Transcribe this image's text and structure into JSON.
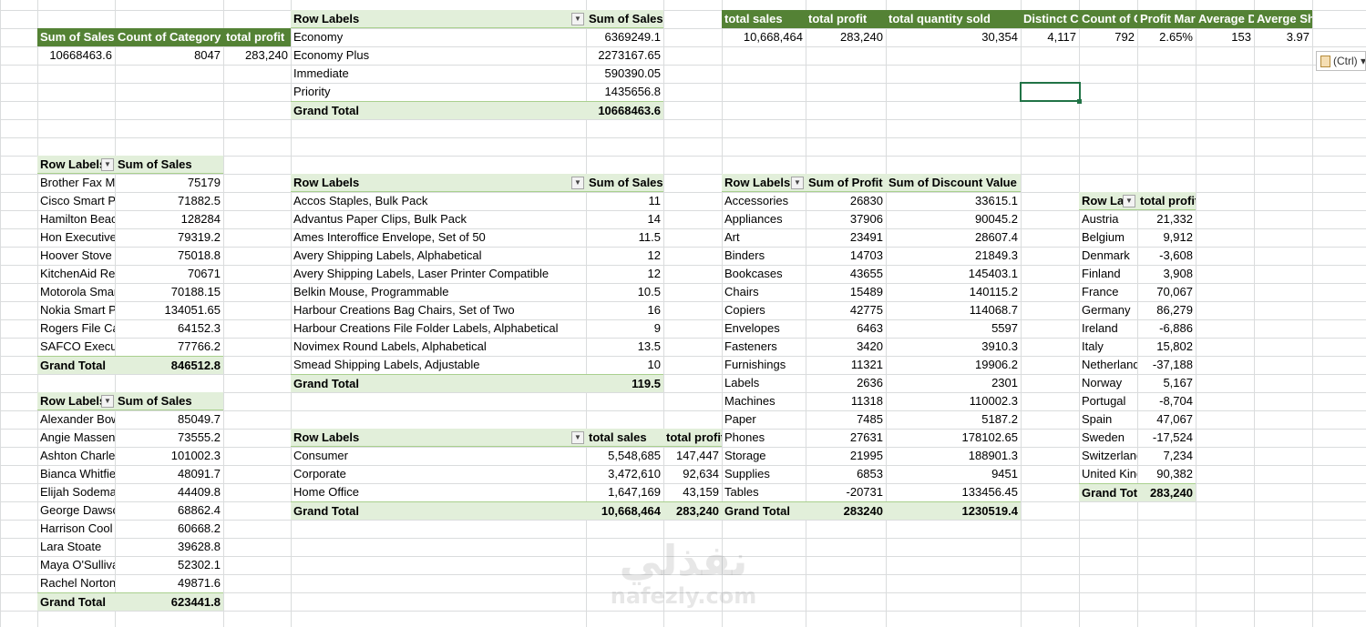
{
  "kpi_small": {
    "headers": [
      "Sum of Sales",
      "Count of Category",
      "total profit"
    ],
    "values": [
      "10668463.6",
      "8047",
      "283,240"
    ]
  },
  "pivot_shipmode": {
    "row_label": "Row Labels",
    "value_label": "Sum of Sales",
    "rows": [
      {
        "label": "Economy",
        "value": "6369249.1"
      },
      {
        "label": "Economy Plus",
        "value": "2273167.65"
      },
      {
        "label": "Immediate",
        "value": "590390.05"
      },
      {
        "label": "Priority",
        "value": "1435656.8"
      }
    ],
    "total_label": "Grand Total",
    "total_value": "10668463.6"
  },
  "kpi_wide": {
    "headers": [
      "total sales",
      "total profit",
      "total quantity sold",
      "Distinct Co",
      "Count of C",
      "Profit Mar",
      "Average D",
      "Averge Sh"
    ],
    "values": [
      "10,668,464",
      "283,240",
      "30,354",
      "4,117",
      "792",
      "2.65%",
      "153",
      "3.97"
    ]
  },
  "paste_options": {
    "label": "(Ctrl)"
  },
  "pivot_products": {
    "row_label": "Row Labels",
    "value_label": "Sum of Sales",
    "rows": [
      {
        "label": "Brother Fax Machine",
        "value": "75179"
      },
      {
        "label": "Cisco Smart Phone",
        "value": "71882.5"
      },
      {
        "label": "Hamilton Beach",
        "value": "128284"
      },
      {
        "label": "Hon Executive",
        "value": "79319.2"
      },
      {
        "label": "Hoover Stove",
        "value": "75018.8"
      },
      {
        "label": "KitchenAid Refrigerator",
        "value": "70671"
      },
      {
        "label": "Motorola Smart Phone",
        "value": "70188.15"
      },
      {
        "label": "Nokia Smart Phone",
        "value": "134051.65"
      },
      {
        "label": "Rogers File Cart",
        "value": "64152.3"
      },
      {
        "label": "SAFCO Executive",
        "value": "77766.2"
      }
    ],
    "total_label": "Grand Total",
    "total_value": "846512.8"
  },
  "pivot_customers": {
    "row_label": "Row Labels",
    "value_label": "Sum of Sales",
    "rows": [
      {
        "label": "Alexander Bowen",
        "value": "85049.7"
      },
      {
        "label": "Angie Massengill",
        "value": "73555.2"
      },
      {
        "label": "Ashton Charles",
        "value": "101002.3"
      },
      {
        "label": "Bianca Whitfield",
        "value": "48091.7"
      },
      {
        "label": "Elijah Sodema",
        "value": "44409.8"
      },
      {
        "label": "George Dawson",
        "value": "68862.4"
      },
      {
        "label": "Harrison Cool",
        "value": "60668.2"
      },
      {
        "label": "Lara Stoate",
        "value": "39628.8"
      },
      {
        "label": "Maya O'Sullivan",
        "value": "52302.1"
      },
      {
        "label": "Rachel Norton",
        "value": "49871.6"
      }
    ],
    "total_label": "Grand Total",
    "total_value": "623441.8"
  },
  "pivot_items": {
    "row_label": "Row Labels",
    "value_label": "Sum of Sales",
    "rows": [
      {
        "label": "Accos Staples, Bulk Pack",
        "value": "11"
      },
      {
        "label": "Advantus Paper Clips, Bulk Pack",
        "value": "14"
      },
      {
        "label": "Ames Interoffice Envelope, Set of 50",
        "value": "11.5"
      },
      {
        "label": "Avery Shipping Labels, Alphabetical",
        "value": "12"
      },
      {
        "label": "Avery Shipping Labels, Laser Printer Compatible",
        "value": "12"
      },
      {
        "label": "Belkin Mouse, Programmable",
        "value": "10.5"
      },
      {
        "label": "Harbour Creations Bag Chairs, Set of Two",
        "value": "16"
      },
      {
        "label": "Harbour Creations File Folder Labels, Alphabetical",
        "value": "9"
      },
      {
        "label": "Novimex Round Labels, Alphabetical",
        "value": "13.5"
      },
      {
        "label": "Smead Shipping Labels, Adjustable",
        "value": "10"
      }
    ],
    "total_label": "Grand Total",
    "total_value": "119.5"
  },
  "pivot_segment": {
    "row_label": "Row Labels",
    "sales_label": "total sales",
    "profit_label": "total profit",
    "rows": [
      {
        "label": "Consumer",
        "sales": "5,548,685",
        "profit": "147,447"
      },
      {
        "label": "Corporate",
        "sales": "3,472,610",
        "profit": "92,634"
      },
      {
        "label": "Home Office",
        "sales": "1,647,169",
        "profit": "43,159"
      }
    ],
    "total_label": "Grand Total",
    "total_sales": "10,668,464",
    "total_profit": "283,240"
  },
  "pivot_subcategory": {
    "row_label": "Row Labels",
    "profit_label": "Sum of Profit",
    "discount_label": "Sum of Discount Value",
    "rows": [
      {
        "label": "Accessories",
        "profit": "26830",
        "discount": "33615.1"
      },
      {
        "label": "Appliances",
        "profit": "37906",
        "discount": "90045.2"
      },
      {
        "label": "Art",
        "profit": "23491",
        "discount": "28607.4"
      },
      {
        "label": "Binders",
        "profit": "14703",
        "discount": "21849.3"
      },
      {
        "label": "Bookcases",
        "profit": "43655",
        "discount": "145403.1"
      },
      {
        "label": "Chairs",
        "profit": "15489",
        "discount": "140115.2"
      },
      {
        "label": "Copiers",
        "profit": "42775",
        "discount": "114068.7"
      },
      {
        "label": "Envelopes",
        "profit": "6463",
        "discount": "5597"
      },
      {
        "label": "Fasteners",
        "profit": "3420",
        "discount": "3910.3"
      },
      {
        "label": "Furnishings",
        "profit": "11321",
        "discount": "19906.2"
      },
      {
        "label": "Labels",
        "profit": "2636",
        "discount": "2301"
      },
      {
        "label": "Machines",
        "profit": "11318",
        "discount": "110002.3"
      },
      {
        "label": "Paper",
        "profit": "7485",
        "discount": "5187.2"
      },
      {
        "label": "Phones",
        "profit": "27631",
        "discount": "178102.65"
      },
      {
        "label": "Storage",
        "profit": "21995",
        "discount": "188901.3"
      },
      {
        "label": "Supplies",
        "profit": "6853",
        "discount": "9451"
      },
      {
        "label": "Tables",
        "profit": "-20731",
        "discount": "133456.45"
      }
    ],
    "total_label": "Grand Total",
    "total_profit": "283240",
    "total_discount": "1230519.4"
  },
  "pivot_country": {
    "row_label": "Row La",
    "value_label": "total profit",
    "rows": [
      {
        "label": "Austria",
        "value": "21,332"
      },
      {
        "label": "Belgium",
        "value": "9,912"
      },
      {
        "label": "Denmark",
        "value": "-3,608"
      },
      {
        "label": "Finland",
        "value": "3,908"
      },
      {
        "label": "France",
        "value": "70,067"
      },
      {
        "label": "Germany",
        "value": "86,279"
      },
      {
        "label": "Ireland",
        "value": "-6,886"
      },
      {
        "label": "Italy",
        "value": "15,802"
      },
      {
        "label": "Netherlands",
        "value": "-37,188"
      },
      {
        "label": "Norway",
        "value": "5,167"
      },
      {
        "label": "Portugal",
        "value": "-8,704"
      },
      {
        "label": "Spain",
        "value": "47,067"
      },
      {
        "label": "Sweden",
        "value": "-17,524"
      },
      {
        "label": "Switzerland",
        "value": "7,234"
      },
      {
        "label": "United Kingdom",
        "value": "90,382"
      }
    ],
    "total_label": "Grand Tot",
    "total_value": "283,240"
  },
  "watermark": {
    "arabic": "نفذلي",
    "latin": "nafezly.com"
  }
}
